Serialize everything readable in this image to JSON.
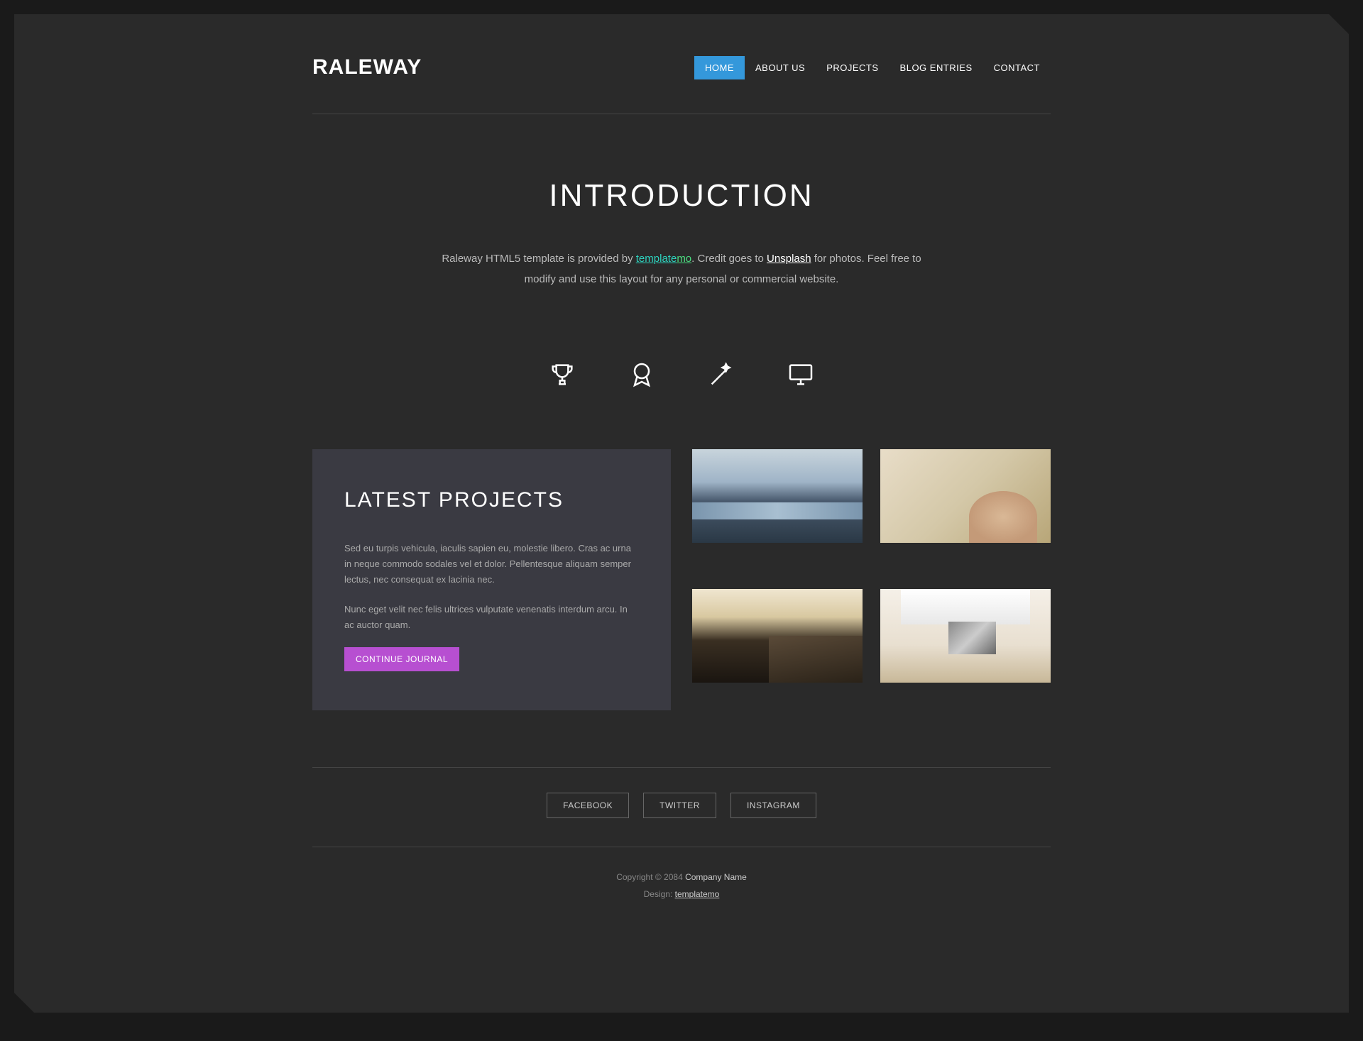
{
  "header": {
    "logo": "RALEWAY",
    "nav": [
      {
        "label": "HOME",
        "active": true
      },
      {
        "label": "ABOUT US",
        "active": false
      },
      {
        "label": "PROJECTS",
        "active": false
      },
      {
        "label": "BLOG ENTRIES",
        "active": false
      },
      {
        "label": "CONTACT",
        "active": false
      }
    ]
  },
  "intro": {
    "title": "INTRODUCTION",
    "text_prefix": "Raleway HTML5 template is provided by ",
    "link1a": "template",
    "link1b": "mo",
    "credit_prefix": ". Credit goes to ",
    "link2": "Unsplash",
    "text_suffix": " for photos. Feel free to modify and use this layout for any personal or commercial website."
  },
  "icons": [
    "trophy-icon",
    "badge-icon",
    "wand-icon",
    "monitor-icon"
  ],
  "projects": {
    "title": "LATEST PROJECTS",
    "para1": "Sed eu turpis vehicula, iaculis sapien eu, molestie libero. Cras ac urna in neque commodo sodales vel et dolor. Pellentesque aliquam semper lectus, nec consequat ex lacinia nec.",
    "para2": "Nunc eget velit nec felis ultrices vulputate venenatis interdum arcu. In ac auctor quam.",
    "button": "CONTINUE JOURNAL"
  },
  "footer": {
    "social": [
      "FACEBOOK",
      "TWITTER",
      "INSTAGRAM"
    ],
    "copy_prefix": "Copyright © 2084 ",
    "company": "Company Name",
    "design_prefix": "Design: ",
    "design_link": "templatemo"
  }
}
